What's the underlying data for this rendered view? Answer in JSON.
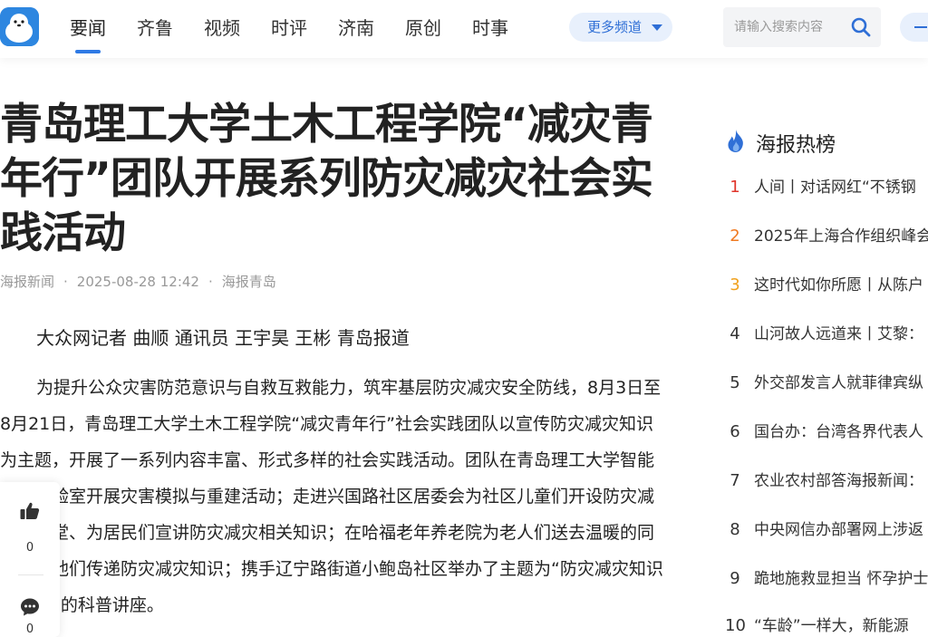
{
  "header": {
    "nav": [
      "要闻",
      "齐鲁",
      "视频",
      "时评",
      "济南",
      "原创",
      "时事"
    ],
    "more_channels": "更多频道",
    "search_placeholder": "请输入搜索内容"
  },
  "article": {
    "title": "青岛理工大学土木工程学院“减灾青年行”团队开展系列防灾减灾社会实践活动",
    "source": "海报新闻",
    "datetime": "2025-08-28 12:42",
    "channel": "海报青岛",
    "byline": "大众网记者 曲顺 通讯员 王宇昊 王彬  青岛报道",
    "paragraph": "为提升公众灾害防范意识与自救互救能力，筑牢基层防灾减灾安全防线，8月3日至8月21日，青岛理工大学土木工程学院“减灾青年行”社会实践团队以宣传防灾减灾知识为主题，开展了一系列内容丰富、形式多样的社会实践活动。团队在青岛理工大学智能建造实验室开展灾害模拟与重建活动；走进兴国路社区居委会为社区儿童们开设防灾减灾小课堂、为居民们宣讲防灾减灾相关知识；在哈福老年养老院为老人们送去温暖的同时，向他们传递防灾减灾知识；携手辽宁路街道小鲍岛社区举办了主题为“防灾减灾知识进社区”的科普讲座。"
  },
  "actions": {
    "like_count": "0",
    "comment_count": "0"
  },
  "sidebar": {
    "title": "海报热榜",
    "items": [
      {
        "rank": "1",
        "text": "人间丨对话网红“不锈钢",
        "color": "#e0352b"
      },
      {
        "rank": "2",
        "text": "2025年上海合作组织峰会",
        "color": "#f07a22"
      },
      {
        "rank": "3",
        "text": "这时代如你所愿丨从陈户",
        "color": "#f0a11e"
      },
      {
        "rank": "4",
        "text": "山河故人远道来丨艾黎：",
        "color": "#333333"
      },
      {
        "rank": "5",
        "text": "外交部发言人就菲律宾纵",
        "color": "#333333"
      },
      {
        "rank": "6",
        "text": "国台办：台湾各界代表人",
        "color": "#333333"
      },
      {
        "rank": "7",
        "text": "农业农村部答海报新闻：",
        "color": "#333333"
      },
      {
        "rank": "8",
        "text": "中央网信办部署网上涉返",
        "color": "#333333"
      },
      {
        "rank": "9",
        "text": "跪地施救显担当 怀孕护士",
        "color": "#333333"
      },
      {
        "rank": "10",
        "text": "“车龄”一样大，新能源",
        "color": "#333333"
      }
    ]
  },
  "colors": {
    "accent": "#2f7ae5",
    "hot": "#2f6fd6"
  }
}
